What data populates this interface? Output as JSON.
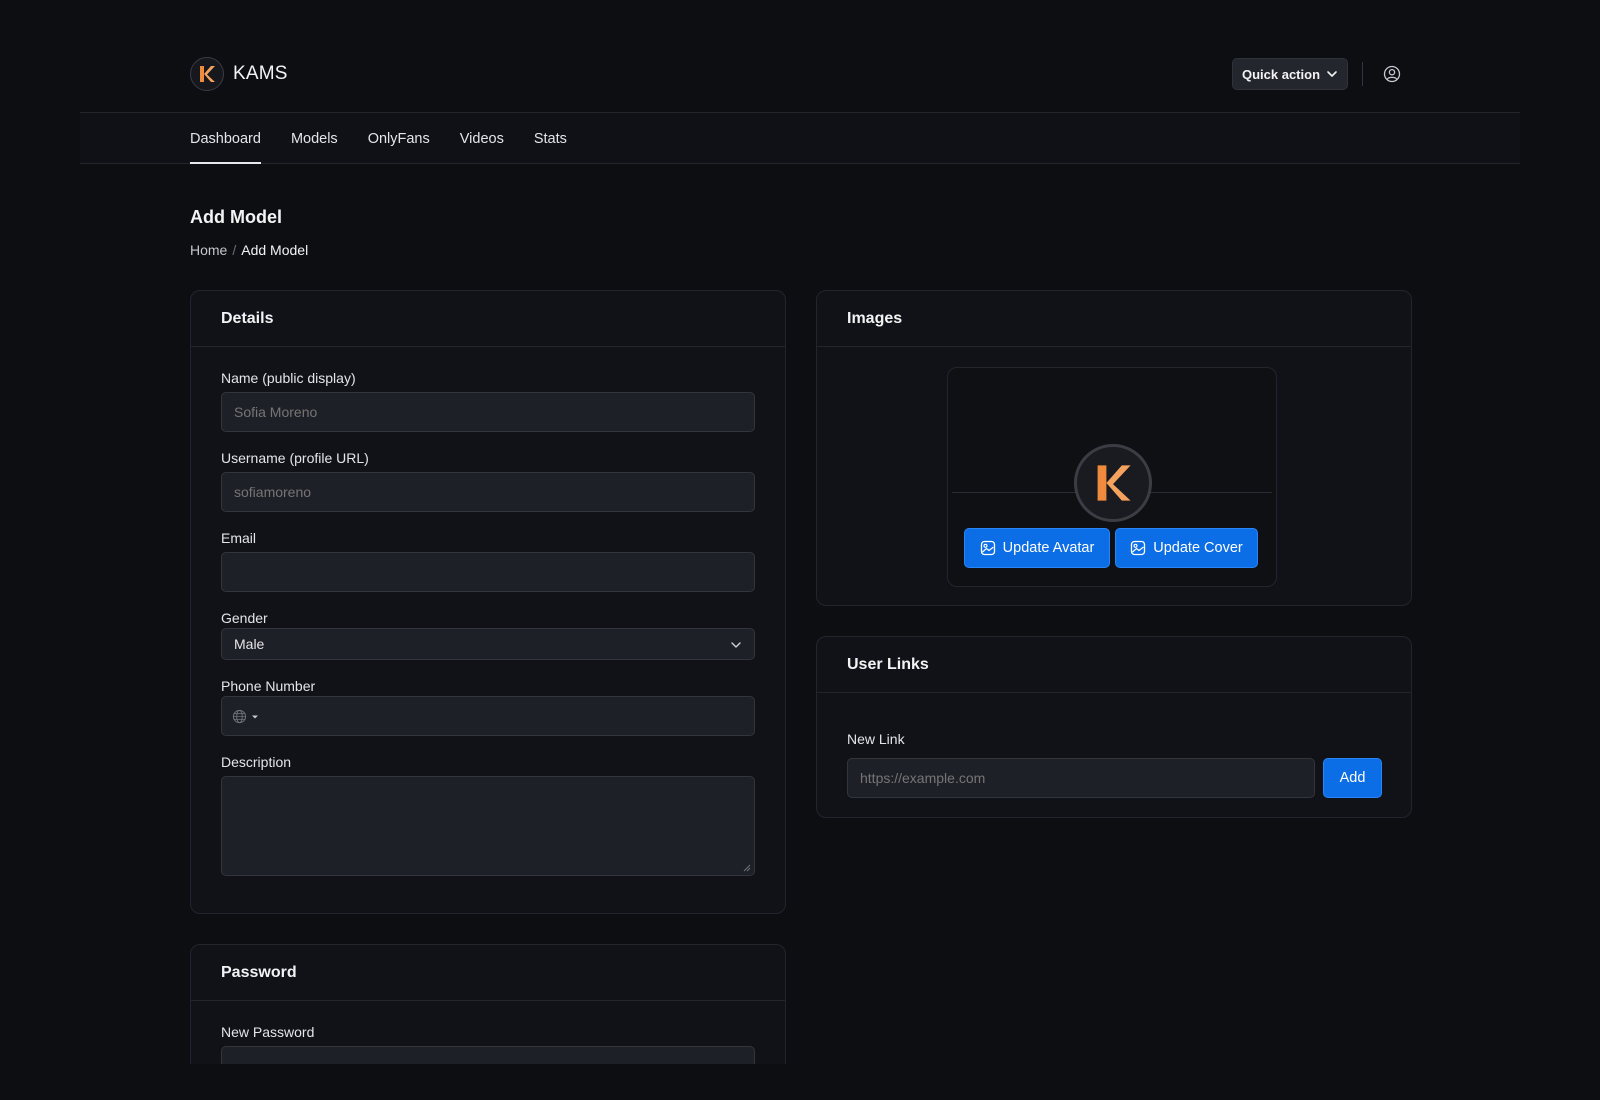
{
  "app": {
    "name": "KAMS",
    "logo_letter": "K"
  },
  "header": {
    "quick_action_label": "Quick action"
  },
  "nav": {
    "items": [
      {
        "label": "Dashboard",
        "active": true
      },
      {
        "label": "Models"
      },
      {
        "label": "OnlyFans"
      },
      {
        "label": "Videos"
      },
      {
        "label": "Stats"
      }
    ]
  },
  "page": {
    "title": "Add Model",
    "breadcrumb": {
      "home": "Home",
      "separator": "/",
      "current": "Add Model"
    }
  },
  "details": {
    "title": "Details",
    "name_label": "Name (public display)",
    "name_placeholder": "Sofia Moreno",
    "username_label": "Username (profile URL)",
    "username_placeholder": "sofiamoreno",
    "email_label": "Email",
    "email_value": "",
    "gender_label": "Gender",
    "gender_value": "Male",
    "phone_label": "Phone Number",
    "phone_value": "",
    "description_label": "Description",
    "description_value": ""
  },
  "password": {
    "title": "Password",
    "new_password_label": "New Password"
  },
  "images": {
    "title": "Images",
    "update_avatar_label": "Update Avatar",
    "update_cover_label": "Update Cover"
  },
  "links": {
    "title": "User Links",
    "new_link_label": "New Link",
    "new_link_placeholder": "https://example.com",
    "add_label": "Add"
  },
  "colors": {
    "accent_blue": "#0c6ee6",
    "brand_orange": "#f08a3c",
    "background": "#0d0e12",
    "card": "#111217",
    "input": "#1e2027"
  }
}
